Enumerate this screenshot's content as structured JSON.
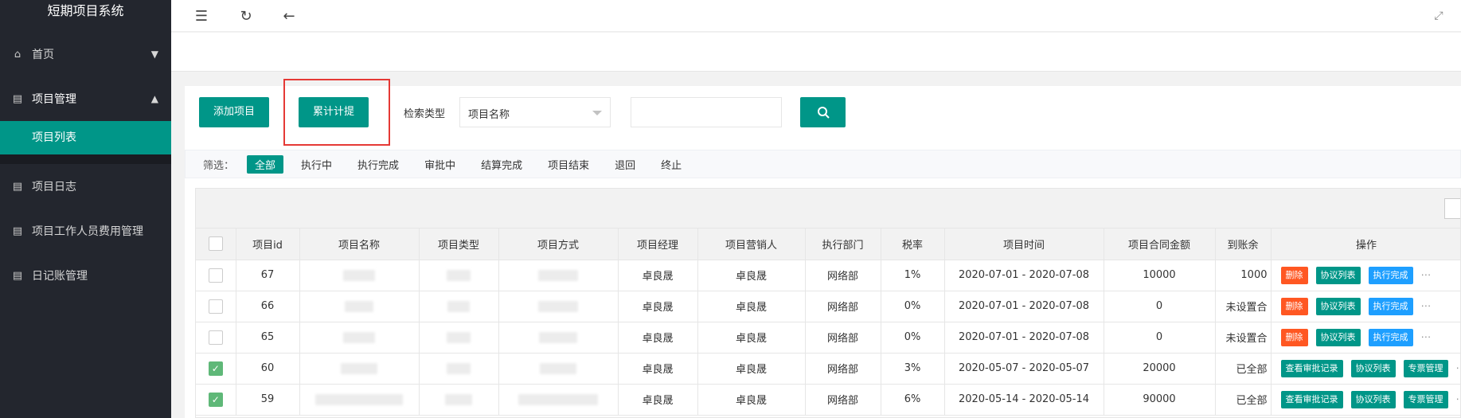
{
  "app": {
    "title": "短期项目系统"
  },
  "sidebar": {
    "items": [
      {
        "label": "首页",
        "icon": "home-icon"
      },
      {
        "label": "项目管理",
        "icon": "document-icon"
      },
      {
        "label": "项目日志",
        "icon": "document-icon"
      },
      {
        "label": "项目工作人员费用管理",
        "icon": "document-icon"
      },
      {
        "label": "日记账管理",
        "icon": "document-icon"
      }
    ],
    "subitems": [
      {
        "label": "项目列表"
      }
    ]
  },
  "toolbar": {
    "add_label": "添加项目",
    "accrue_label": "累计计提",
    "search_type_label": "检索类型",
    "search_type_value": "项目名称",
    "search_placeholder": ""
  },
  "filters": {
    "label": "筛选：",
    "options": [
      "全部",
      "执行中",
      "执行完成",
      "审批中",
      "结算完成",
      "项目结束",
      "退回",
      "终止"
    ],
    "active": "全部"
  },
  "table": {
    "headers": [
      "项目id",
      "项目名称",
      "项目类型",
      "项目方式",
      "项目经理",
      "项目营销人",
      "执行部门",
      "税率",
      "项目时间",
      "项目合同金额",
      "到账余",
      "操作"
    ],
    "rows": [
      {
        "checked": false,
        "id": "67",
        "manager": "卓良晟",
        "marketer": "卓良晟",
        "dept": "网络部",
        "tax": "1%",
        "time": "2020-07-01 - 2020-07-08",
        "amount": "10000",
        "balance": "1000",
        "actions": [
          "删除",
          "协议列表",
          "执行完成"
        ]
      },
      {
        "checked": false,
        "id": "66",
        "manager": "卓良晟",
        "marketer": "卓良晟",
        "dept": "网络部",
        "tax": "0%",
        "time": "2020-07-01 - 2020-07-08",
        "amount": "0",
        "balance": "未设置合",
        "actions": [
          "删除",
          "协议列表",
          "执行完成"
        ]
      },
      {
        "checked": false,
        "id": "65",
        "manager": "卓良晟",
        "marketer": "卓良晟",
        "dept": "网络部",
        "tax": "0%",
        "time": "2020-07-01 - 2020-07-08",
        "amount": "0",
        "balance": "未设置合",
        "actions": [
          "删除",
          "协议列表",
          "执行完成"
        ]
      },
      {
        "checked": true,
        "id": "60",
        "manager": "卓良晟",
        "marketer": "卓良晟",
        "dept": "网络部",
        "tax": "3%",
        "time": "2020-05-07 - 2020-05-07",
        "amount": "20000",
        "balance": "已全部",
        "actions": [
          "查看审批记录",
          "协议列表",
          "专票管理"
        ]
      },
      {
        "checked": true,
        "id": "59",
        "manager": "卓良晟",
        "marketer": "卓良晟",
        "dept": "网络部",
        "tax": "6%",
        "time": "2020-05-14 - 2020-05-14",
        "amount": "90000",
        "balance": "已全部",
        "actions": [
          "查看审批记录",
          "协议列表",
          "专票管理"
        ]
      }
    ]
  },
  "colors": {
    "primary": "#009688",
    "danger": "#ff5722",
    "info": "#1e9fff",
    "sidebar": "#23262e",
    "highlight": "#e53935"
  }
}
